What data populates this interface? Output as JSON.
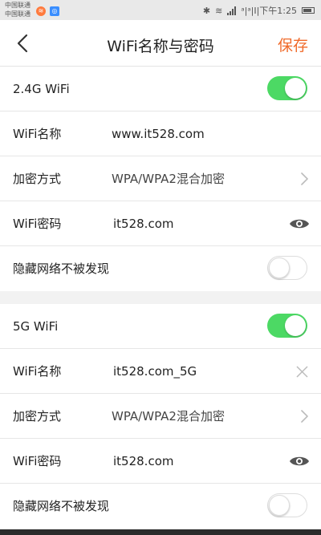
{
  "status_bar": {
    "carrier_1": "中国联通",
    "carrier_2": "中国联通",
    "right_text": "ᵃ|ᵃ|I|下午1:25"
  },
  "header": {
    "title": "WiFi名称与密码",
    "save_label": "保存"
  },
  "wifi_24": {
    "title": "2.4G WiFi",
    "enabled": true,
    "name_label": "WiFi名称",
    "name_value": "www.it528.com",
    "encryption_label": "加密方式",
    "encryption_value": "WPA/WPA2混合加密",
    "password_label": "WiFi密码",
    "password_value": "it528.com",
    "hide_label": "隐藏网络不被发现",
    "hidden": false
  },
  "wifi_5": {
    "title": "5G WiFi",
    "enabled": true,
    "name_label": "WiFi名称",
    "name_value": "it528.com_5G",
    "encryption_label": "加密方式",
    "encryption_value": "WPA/WPA2混合加密",
    "password_label": "WiFi密码",
    "password_value": "it528.com",
    "hide_label": "隐藏网络不被发现",
    "hidden": false
  },
  "colors": {
    "accent": "#f06a2a",
    "toggle_on": "#4cd964"
  },
  "icons": [
    "back-arrow-icon",
    "chevron-right-icon",
    "eye-icon",
    "clear-icon",
    "wifi-icon",
    "bluetooth-icon"
  ]
}
